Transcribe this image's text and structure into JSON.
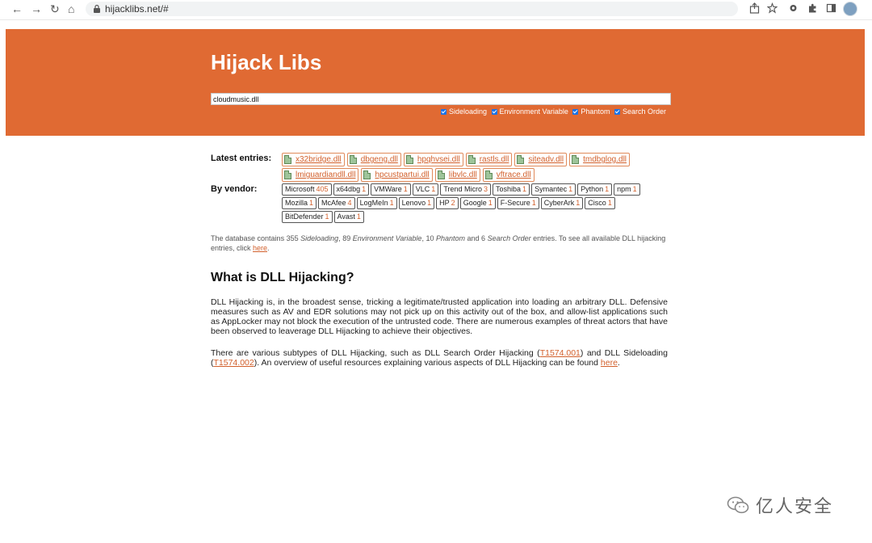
{
  "browser": {
    "url": "hijacklibs.net/#",
    "nav_back": "←",
    "nav_forward": "→",
    "nav_reload": "↻",
    "nav_home": "⌂"
  },
  "hero": {
    "title": "Hijack Libs",
    "search_value": "cloudmusic.dll",
    "filters": [
      {
        "label": "Sideloading",
        "checked": true
      },
      {
        "label": "Environment Variable",
        "checked": true
      },
      {
        "label": "Phantom",
        "checked": true
      },
      {
        "label": "Search Order",
        "checked": true
      }
    ],
    "bg_color": "#e06a33"
  },
  "latest": {
    "label": "Latest entries:",
    "items": [
      "x32bridge.dll",
      "dbgeng.dll",
      "hpqhvsei.dll",
      "rastls.dll",
      "siteadv.dll",
      "tmdbglog.dll",
      "lmiguardiandll.dll",
      "hpcustpartui.dll",
      "libvlc.dll",
      "vftrace.dll"
    ]
  },
  "vendors": {
    "label": "By vendor:",
    "items": [
      {
        "name": "Microsoft",
        "count": "405"
      },
      {
        "name": "x64dbg",
        "count": "1"
      },
      {
        "name": "VMWare",
        "count": "1"
      },
      {
        "name": "VLC",
        "count": "1"
      },
      {
        "name": "Trend Micro",
        "count": "3"
      },
      {
        "name": "Toshiba",
        "count": "1"
      },
      {
        "name": "Symantec",
        "count": "1"
      },
      {
        "name": "Python",
        "count": "1"
      },
      {
        "name": "npm",
        "count": "1"
      },
      {
        "name": "Mozilla",
        "count": "1"
      },
      {
        "name": "McAfee",
        "count": "4"
      },
      {
        "name": "LogMeIn",
        "count": "1"
      },
      {
        "name": "Lenovo",
        "count": "1"
      },
      {
        "name": "HP",
        "count": "2"
      },
      {
        "name": "Google",
        "count": "1"
      },
      {
        "name": "F-Secure",
        "count": "1"
      },
      {
        "name": "CyberArk",
        "count": "1"
      },
      {
        "name": "Cisco",
        "count": "1"
      },
      {
        "name": "BitDefender",
        "count": "1"
      },
      {
        "name": "Avast",
        "count": "1"
      }
    ]
  },
  "database_note": {
    "prefix": "The database contains ",
    "sideloading_count": "355",
    "sideloading_label": "Sideloading",
    "env_count": "89",
    "env_label": "Environment Variable",
    "phantom_count": "10",
    "phantom_label": "Phantom",
    "search_order_count": "6",
    "search_order_label": "Search Order",
    "suffix": " entries. To see all available DLL hijacking entries, click ",
    "link_text": "here",
    "end": "."
  },
  "article": {
    "title": "What is DLL Hijacking?",
    "paragraph1": "DLL Hijacking is, in the broadest sense, tricking a legitimate/trusted application into loading an arbitrary DLL. Defensive measures such as AV and EDR solutions may not pick up on this activity out of the box, and allow-list applications such as AppLocker may not block the execution of the untrusted code. There are numerous examples of threat actors that have been observed to leaverage DLL Hijacking to achieve their objectives.",
    "p2_part1": "There are various subtypes of DLL Hijacking, such as DLL Search Order Hijacking (",
    "p2_link1": "T1574.001",
    "p2_part2": ") and DLL Sideloading (",
    "p2_link2": "T1574.002",
    "p2_part3": "). An overview of useful resources explaining various aspects of DLL Hijacking can be found ",
    "p2_link3": "here",
    "p2_end": "."
  },
  "watermark": {
    "text": "亿人安全"
  },
  "colors": {
    "accent": "#e06a33",
    "link": "#d2602c"
  }
}
